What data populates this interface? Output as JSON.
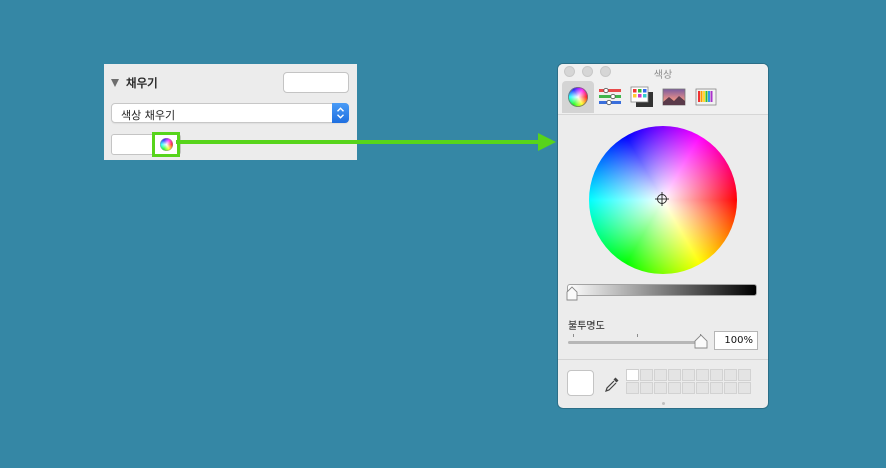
{
  "fill_panel": {
    "title": "채우기",
    "fill_type": "색상 채우기"
  },
  "color_window": {
    "title": "색상",
    "tabs": [
      {
        "name": "color-wheel",
        "active": true
      },
      {
        "name": "color-sliders",
        "active": false
      },
      {
        "name": "color-palettes",
        "active": false
      },
      {
        "name": "image-palettes",
        "active": false
      },
      {
        "name": "pencils",
        "active": false
      }
    ],
    "opacity_label": "불투명도",
    "opacity_value": "100%",
    "opacity_level": 1.0,
    "brightness_level": 1.0
  },
  "colors": {
    "background": "#3587a5",
    "highlight": "#57d41b",
    "select_accent": "#1f6fe0"
  }
}
